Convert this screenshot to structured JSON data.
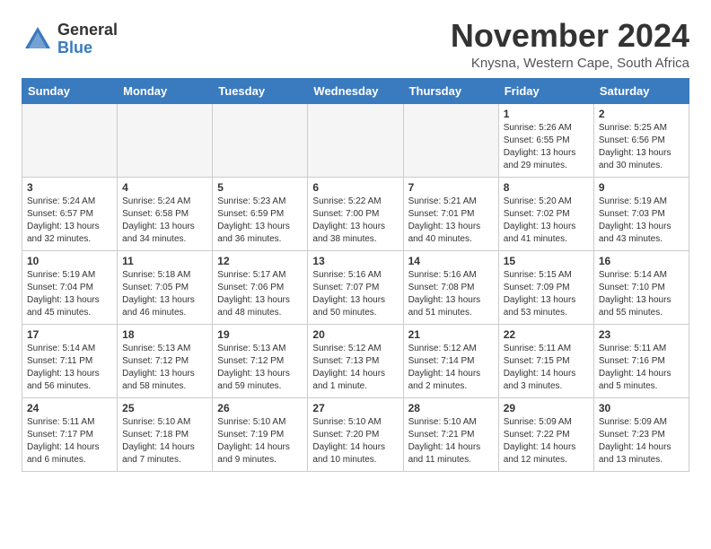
{
  "logo": {
    "general": "General",
    "blue": "Blue"
  },
  "title": "November 2024",
  "location": "Knysna, Western Cape, South Africa",
  "days_header": [
    "Sunday",
    "Monday",
    "Tuesday",
    "Wednesday",
    "Thursday",
    "Friday",
    "Saturday"
  ],
  "weeks": [
    [
      {
        "day": "",
        "info": ""
      },
      {
        "day": "",
        "info": ""
      },
      {
        "day": "",
        "info": ""
      },
      {
        "day": "",
        "info": ""
      },
      {
        "day": "",
        "info": ""
      },
      {
        "day": "1",
        "info": "Sunrise: 5:26 AM\nSunset: 6:55 PM\nDaylight: 13 hours and 29 minutes."
      },
      {
        "day": "2",
        "info": "Sunrise: 5:25 AM\nSunset: 6:56 PM\nDaylight: 13 hours and 30 minutes."
      }
    ],
    [
      {
        "day": "3",
        "info": "Sunrise: 5:24 AM\nSunset: 6:57 PM\nDaylight: 13 hours and 32 minutes."
      },
      {
        "day": "4",
        "info": "Sunrise: 5:24 AM\nSunset: 6:58 PM\nDaylight: 13 hours and 34 minutes."
      },
      {
        "day": "5",
        "info": "Sunrise: 5:23 AM\nSunset: 6:59 PM\nDaylight: 13 hours and 36 minutes."
      },
      {
        "day": "6",
        "info": "Sunrise: 5:22 AM\nSunset: 7:00 PM\nDaylight: 13 hours and 38 minutes."
      },
      {
        "day": "7",
        "info": "Sunrise: 5:21 AM\nSunset: 7:01 PM\nDaylight: 13 hours and 40 minutes."
      },
      {
        "day": "8",
        "info": "Sunrise: 5:20 AM\nSunset: 7:02 PM\nDaylight: 13 hours and 41 minutes."
      },
      {
        "day": "9",
        "info": "Sunrise: 5:19 AM\nSunset: 7:03 PM\nDaylight: 13 hours and 43 minutes."
      }
    ],
    [
      {
        "day": "10",
        "info": "Sunrise: 5:19 AM\nSunset: 7:04 PM\nDaylight: 13 hours and 45 minutes."
      },
      {
        "day": "11",
        "info": "Sunrise: 5:18 AM\nSunset: 7:05 PM\nDaylight: 13 hours and 46 minutes."
      },
      {
        "day": "12",
        "info": "Sunrise: 5:17 AM\nSunset: 7:06 PM\nDaylight: 13 hours and 48 minutes."
      },
      {
        "day": "13",
        "info": "Sunrise: 5:16 AM\nSunset: 7:07 PM\nDaylight: 13 hours and 50 minutes."
      },
      {
        "day": "14",
        "info": "Sunrise: 5:16 AM\nSunset: 7:08 PM\nDaylight: 13 hours and 51 minutes."
      },
      {
        "day": "15",
        "info": "Sunrise: 5:15 AM\nSunset: 7:09 PM\nDaylight: 13 hours and 53 minutes."
      },
      {
        "day": "16",
        "info": "Sunrise: 5:14 AM\nSunset: 7:10 PM\nDaylight: 13 hours and 55 minutes."
      }
    ],
    [
      {
        "day": "17",
        "info": "Sunrise: 5:14 AM\nSunset: 7:11 PM\nDaylight: 13 hours and 56 minutes."
      },
      {
        "day": "18",
        "info": "Sunrise: 5:13 AM\nSunset: 7:12 PM\nDaylight: 13 hours and 58 minutes."
      },
      {
        "day": "19",
        "info": "Sunrise: 5:13 AM\nSunset: 7:12 PM\nDaylight: 13 hours and 59 minutes."
      },
      {
        "day": "20",
        "info": "Sunrise: 5:12 AM\nSunset: 7:13 PM\nDaylight: 14 hours and 1 minute."
      },
      {
        "day": "21",
        "info": "Sunrise: 5:12 AM\nSunset: 7:14 PM\nDaylight: 14 hours and 2 minutes."
      },
      {
        "day": "22",
        "info": "Sunrise: 5:11 AM\nSunset: 7:15 PM\nDaylight: 14 hours and 3 minutes."
      },
      {
        "day": "23",
        "info": "Sunrise: 5:11 AM\nSunset: 7:16 PM\nDaylight: 14 hours and 5 minutes."
      }
    ],
    [
      {
        "day": "24",
        "info": "Sunrise: 5:11 AM\nSunset: 7:17 PM\nDaylight: 14 hours and 6 minutes."
      },
      {
        "day": "25",
        "info": "Sunrise: 5:10 AM\nSunset: 7:18 PM\nDaylight: 14 hours and 7 minutes."
      },
      {
        "day": "26",
        "info": "Sunrise: 5:10 AM\nSunset: 7:19 PM\nDaylight: 14 hours and 9 minutes."
      },
      {
        "day": "27",
        "info": "Sunrise: 5:10 AM\nSunset: 7:20 PM\nDaylight: 14 hours and 10 minutes."
      },
      {
        "day": "28",
        "info": "Sunrise: 5:10 AM\nSunset: 7:21 PM\nDaylight: 14 hours and 11 minutes."
      },
      {
        "day": "29",
        "info": "Sunrise: 5:09 AM\nSunset: 7:22 PM\nDaylight: 14 hours and 12 minutes."
      },
      {
        "day": "30",
        "info": "Sunrise: 5:09 AM\nSunset: 7:23 PM\nDaylight: 14 hours and 13 minutes."
      }
    ]
  ]
}
